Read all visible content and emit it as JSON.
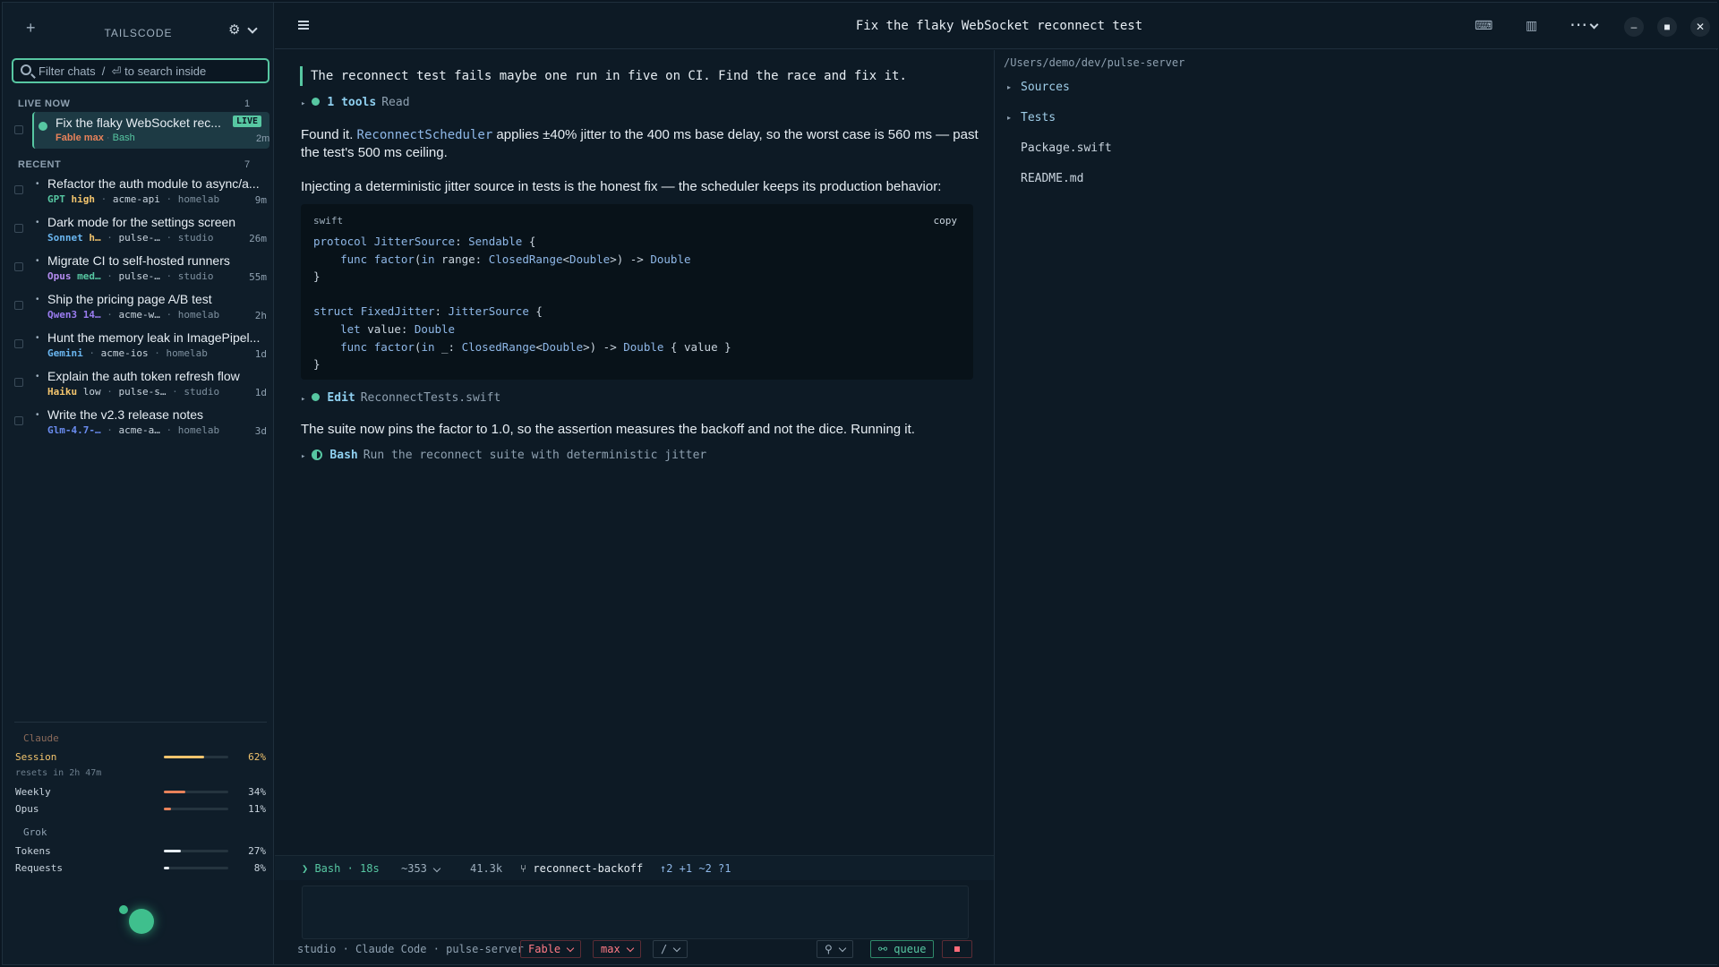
{
  "sidebar": {
    "brand": "TAILSCODE",
    "new_label": "+",
    "search": {
      "placeholder": "Filter chats  /  ⏎ to search inside",
      "value": ""
    },
    "live": {
      "header": "LIVE NOW",
      "count": "1",
      "item": {
        "title": "Fix the flaky WebSocket rec...",
        "badge": "LIVE",
        "model": "Fable",
        "effort": "max",
        "tool": "Bash",
        "time": "2m"
      }
    },
    "recent": {
      "header": "RECENT",
      "count": "7",
      "items": [
        {
          "title": "Refactor the auth module to async/a...",
          "model": "GPT",
          "effort": "high",
          "repo": "acme-api",
          "host": "homelab",
          "time": "9m"
        },
        {
          "title": "Dark mode for the settings screen",
          "model": "Sonnet",
          "effort": "h…",
          "repo": "pulse-…",
          "host": "studio",
          "time": "26m"
        },
        {
          "title": "Migrate CI to self-hosted runners",
          "model": "Opus",
          "effort": "med…",
          "repo": "pulse-…",
          "host": "studio",
          "time": "55m"
        },
        {
          "title": "Ship the pricing page A/B test",
          "model": "Qwen3",
          "effort": "14…",
          "repo": "acme-w…",
          "host": "homelab",
          "time": "2h"
        },
        {
          "title": "Hunt the memory leak in ImagePipel...",
          "model": "Gemini",
          "effort": "",
          "repo": "acme-ios",
          "host": "homelab",
          "time": "1d"
        },
        {
          "title": "Explain the auth token refresh flow",
          "model": "Haiku",
          "effort": "low",
          "repo": "pulse-s…",
          "host": "studio",
          "time": "1d"
        },
        {
          "title": "Write the v2.3 release notes",
          "model": "Glm-4.7-…",
          "effort": "",
          "repo": "acme-a…",
          "host": "homelab",
          "time": "3d"
        }
      ]
    },
    "usage": {
      "claude": {
        "header": "Claude",
        "rows": [
          {
            "label": "Session",
            "pct": "62%",
            "value": 0.62,
            "color": "#f2c46d"
          },
          {
            "label": "Weekly",
            "pct": "34%",
            "value": 0.34,
            "color": "#e8825a"
          },
          {
            "label": "Opus",
            "pct": "11%",
            "value": 0.11,
            "color": "#e8825a"
          }
        ],
        "note": "resets in 2h 47m"
      },
      "grok": {
        "header": "Grok",
        "rows": [
          {
            "label": "Tokens",
            "pct": "27%",
            "value": 0.27,
            "color": "#e6edf3"
          },
          {
            "label": "Requests",
            "pct": "8%",
            "value": 0.08,
            "color": "#e6edf3"
          }
        ]
      }
    }
  },
  "header": {
    "title": "Fix the flaky WebSocket reconnect test",
    "icons": [
      "terminal-icon",
      "split-view-icon",
      "more-icon"
    ]
  },
  "chat": {
    "prompt": "The reconnect test fails maybe one run in five on CI. Find the race and fix it.",
    "tool1": {
      "name": "1 tools",
      "arg": "Read"
    },
    "para1_pre": "Found it. ",
    "para1_code": "ReconnectScheduler",
    "para1_post": " applies ±40% jitter to the 400 ms base delay, so the worst case is 560 ms — past the test's 500 ms ceiling.",
    "para2": "Injecting a deterministic jitter source in tests is the honest fix — the scheduler keeps its production behavior:",
    "code": {
      "lang": "swift",
      "copy_label": "copy"
    },
    "tool2": {
      "name": "Edit",
      "arg": "ReconnectTests.swift"
    },
    "para3": "The suite now pins the factor to 1.0, so the assertion measures the backoff and not the dice. Running it.",
    "tool3": {
      "name": "Bash",
      "arg": "Run the reconnect suite with deterministic jitter"
    }
  },
  "status": {
    "tool": "❯ Bash · 18s",
    "lines": "~353",
    "tokens": "41.3k",
    "branch": "⑂ reconnect-backoff",
    "diff": "↑2 +1 ~2 ?1"
  },
  "footer": {
    "context": "studio · Claude Code · pulse-server",
    "model": "Fable",
    "effort": "max",
    "slash": "/",
    "queue": "queue",
    "attach_icon": "paperclip-icon"
  },
  "files": {
    "path": "/Users/demo/dev/pulse-server",
    "entries": [
      {
        "name": "Sources",
        "type": "dir"
      },
      {
        "name": "Tests",
        "type": "dir"
      },
      {
        "name": "Package.swift",
        "type": "file"
      },
      {
        "name": "README.md",
        "type": "file"
      }
    ]
  },
  "colors": {
    "accent": "#57c7a2",
    "live_badge": "#57c7a2",
    "stop": "#ff6b7a"
  }
}
